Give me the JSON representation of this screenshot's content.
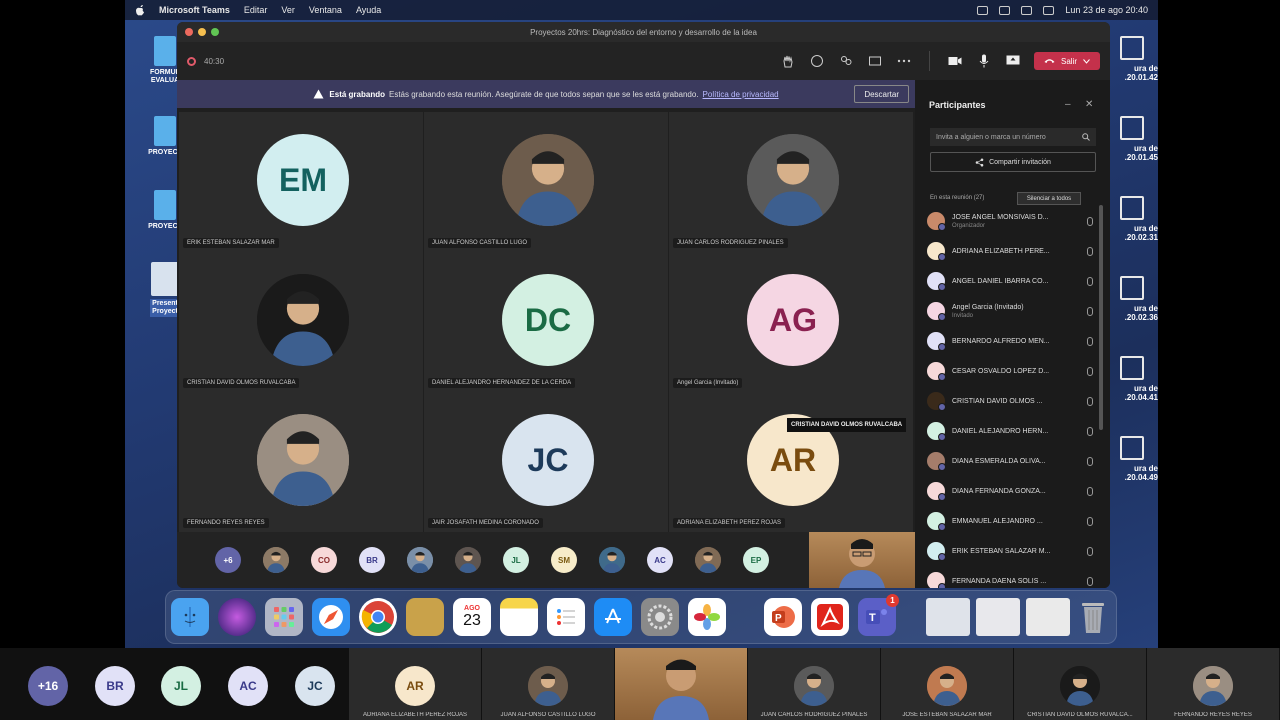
{
  "menubar": {
    "app": "Microsoft Teams",
    "items": [
      "Editar",
      "Ver",
      "Ventana",
      "Ayuda"
    ],
    "datetime": "Lun 23 de ago  20:40"
  },
  "desktop": {
    "left_icons": [
      "FORMUL\nEVALUA",
      "PROYECT",
      "PROYECT",
      "Present\nProyect"
    ],
    "right_icons": [
      "ura de\n.20.01.42",
      "ura de\n.20.01.45",
      "ura de\n.20.02.31",
      "ura de\n.20.02.36",
      "ura de\n.20.04.41",
      "ura de\n.20.04.49"
    ]
  },
  "window": {
    "title": "Proyectos 20hrs: Diagnóstico del entorno y desarrollo de la idea",
    "timer": "40:30",
    "leave_label": "Salir"
  },
  "banner": {
    "bold": "Está grabando",
    "text": "Estás grabando esta reunión. Asegúrate de que todos sepan que se les está grabando.",
    "link": "Política de privacidad",
    "dismiss": "Descartar"
  },
  "grid": [
    {
      "initials": "EM",
      "name": "ERIK ESTEBAN SALAZAR MAR",
      "bg": "#d2eef0",
      "fg": "#13615f",
      "photo": false
    },
    {
      "initials": "",
      "name": "JUAN ALFONSO CASTILLO LUGO",
      "bg": "#6d5c4c",
      "fg": "#fff",
      "photo": true
    },
    {
      "initials": "",
      "name": "JUAN CARLOS RODRIGUEZ PINALES",
      "bg": "#5a5a5a",
      "fg": "#fff",
      "photo": true
    },
    {
      "initials": "",
      "name": "CRISTIAN DAVID OLMOS RUVALCABA",
      "bg": "#1a1a1a",
      "fg": "#d9a01e",
      "photo": true
    },
    {
      "initials": "DC",
      "name": "DANIEL ALEJANDRO HERNANDEZ DE LA CERDA",
      "bg": "#d3f0e2",
      "fg": "#1a6b44",
      "photo": false
    },
    {
      "initials": "AG",
      "name": "Angel Garcia (Invitado)",
      "bg": "#f5d6e3",
      "fg": "#8a2150",
      "photo": false
    },
    {
      "initials": "",
      "name": "FERNANDO REYES REYES",
      "bg": "#9a8e82",
      "fg": "#fff",
      "photo": true
    },
    {
      "initials": "JC",
      "name": "JAIR JOSAFATH MEDINA CORONADO",
      "bg": "#d9e4ef",
      "fg": "#1d3a5a",
      "photo": false
    },
    {
      "initials": "AR",
      "name": "ADRIANA ELIZABETH PEREZ ROJAS",
      "bg": "#f7e7cb",
      "fg": "#7a4c0f",
      "photo": false
    }
  ],
  "strip": [
    {
      "label": "+6",
      "bg": "#6264a7",
      "fg": "#fff"
    },
    {
      "label": "",
      "bg": "#8d7a66",
      "fg": "#fff"
    },
    {
      "label": "CO",
      "bg": "#f7d9d9",
      "fg": "#8a2b2b"
    },
    {
      "label": "BR",
      "bg": "#e1e1f7",
      "fg": "#3a3a8a"
    },
    {
      "label": "",
      "bg": "#7a8fa8",
      "fg": "#fff"
    },
    {
      "label": "",
      "bg": "#5e5550",
      "fg": "#fff"
    },
    {
      "label": "JL",
      "bg": "#d3f0e2",
      "fg": "#1a6b44"
    },
    {
      "label": "SM",
      "bg": "#f7ecc9",
      "fg": "#7a5a10"
    },
    {
      "label": "",
      "bg": "#3f6a8a",
      "fg": "#fff"
    },
    {
      "label": "AC",
      "bg": "#e1e1f7",
      "fg": "#3a3a8a"
    },
    {
      "label": "",
      "bg": "#806a55",
      "fg": "#fff"
    },
    {
      "label": "EP",
      "bg": "#d3f0e2",
      "fg": "#1a6b44"
    }
  ],
  "panel": {
    "title": "Participantes",
    "invite_placeholder": "Invita a alguien o marca un número",
    "share_label": "Compartir invitación",
    "in_meeting": "En esta reunión (27)",
    "mute_all": "Silenciar a todos",
    "tooltip": "CRISTIAN DAVID OLMOS RUVALCABA",
    "participants": [
      {
        "name": "JOSE ANGEL MONSIVAIS D...",
        "role": "Organizador",
        "color": "#c98a6a"
      },
      {
        "name": "ADRIANA ELIZABETH PERE...",
        "role": "",
        "color": "#f7e7cb"
      },
      {
        "name": "ANGEL DANIEL IBARRA CO...",
        "role": "",
        "color": "#e1e1f7"
      },
      {
        "name": "Angel Garcia (Invitado)",
        "role": "Invitado",
        "color": "#f5d6e3"
      },
      {
        "name": "BERNARDO ALFREDO MEN...",
        "role": "",
        "color": "#e1e1f7"
      },
      {
        "name": "CESAR OSVALDO LOPEZ D...",
        "role": "",
        "color": "#f7d9d9"
      },
      {
        "name": "CRISTIAN DAVID OLMOS ...",
        "role": "",
        "color": "#3a2a1a"
      },
      {
        "name": "DANIEL ALEJANDRO HERN...",
        "role": "",
        "color": "#d3f0e2"
      },
      {
        "name": "DIANA ESMERALDA OLIVA...",
        "role": "",
        "color": "#a57d6b"
      },
      {
        "name": "DIANA FERNANDA GONZA...",
        "role": "",
        "color": "#f7d9d9"
      },
      {
        "name": "EMMANUEL ALEJANDRO ...",
        "role": "",
        "color": "#d3f0e2"
      },
      {
        "name": "ERIK ESTEBAN SALAZAR M...",
        "role": "",
        "color": "#d2eef0"
      },
      {
        "name": "FERNANDA DAENA SOLIS ...",
        "role": "",
        "color": "#f7d9d9"
      }
    ]
  },
  "dock": {
    "calendar_day": "23",
    "calendar_month": "AGO",
    "teams_badge": "1"
  },
  "outer": {
    "circles": [
      {
        "label": "+16",
        "bg": "#6264a7",
        "fg": "#fff"
      },
      {
        "label": "BR",
        "bg": "#e1e1f7",
        "fg": "#3a3a8a"
      },
      {
        "label": "JL",
        "bg": "#d3f0e2",
        "fg": "#1a6b44"
      },
      {
        "label": "AC",
        "bg": "#e1e1f7",
        "fg": "#3a3a8a"
      },
      {
        "label": "JC",
        "bg": "#d9e4ef",
        "fg": "#1d3a5a"
      }
    ],
    "tiles": [
      {
        "initials": "AR",
        "name": "ADRIANA ELIZABETH PEREZ ROJAS",
        "bg": "#f7e7cb",
        "fg": "#7a4c0f",
        "photo": false
      },
      {
        "initials": "",
        "name": "JUAN ALFONSO CASTILLO LUGO",
        "bg": "#6d5c4c",
        "fg": "#fff",
        "photo": true
      },
      {
        "initials": "",
        "name": "",
        "bg": "#b68a5a",
        "fg": "#fff",
        "photo": true,
        "video": true
      },
      {
        "initials": "",
        "name": "JUAN CARLOS RODRIGUEZ PINALES",
        "bg": "#5a5a5a",
        "fg": "#fff",
        "photo": true
      },
      {
        "initials": "",
        "name": "JOSE ESTEBAN SALAZAR MAR",
        "bg": "#c07a50",
        "fg": "#fff",
        "photo": true
      },
      {
        "initials": "",
        "name": "CRISTIAN DAVID OLMOS RUVALCA...",
        "bg": "#1a1a1a",
        "fg": "#d9a01e",
        "photo": true
      },
      {
        "initials": "",
        "name": "FERNANDO REYES REYES",
        "bg": "#9a8e82",
        "fg": "#fff",
        "photo": true
      }
    ]
  }
}
